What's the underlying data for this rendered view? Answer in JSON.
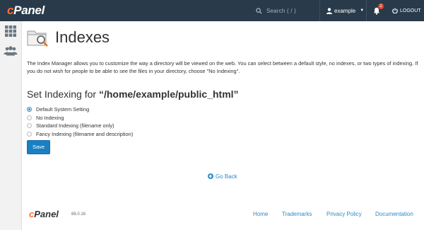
{
  "app": {
    "logo_text": "cPanel",
    "search_placeholder": "Search ( / )",
    "username": "example",
    "notification_count": "2",
    "logout_label": "LOGOUT"
  },
  "sidebar": {
    "items": [
      {
        "icon": "grid-icon"
      },
      {
        "icon": "users-icon"
      }
    ]
  },
  "page": {
    "title": "Indexes",
    "description": "The Index Manager allows you to customize the way a directory will be viewed on the web. You can select between a default style, no indexes, or two types of indexing. If you do not wish for people to be able to see the files in your directory, choose \"No Indexing\".",
    "section_prefix": "Set Indexing for ",
    "section_path": "“/home/example/public_html”",
    "options": [
      {
        "label": "Default System Setting",
        "selected": true
      },
      {
        "label": "No Indexing",
        "selected": false
      },
      {
        "label": "Standard Indexing (filename only)",
        "selected": false
      },
      {
        "label": "Fancy Indexing (filename and description)",
        "selected": false
      }
    ],
    "save_label": "Save",
    "go_back_label": "Go Back"
  },
  "footer": {
    "logo_text": "cPanel",
    "version": "86.0.16",
    "links": [
      "Home",
      "Trademarks",
      "Privacy Policy",
      "Documentation"
    ]
  },
  "colors": {
    "topbar": "#293a4a",
    "brand_orange": "#ff6c2c",
    "primary_blue": "#1b7fc3",
    "link_blue": "#2d8ac7"
  }
}
